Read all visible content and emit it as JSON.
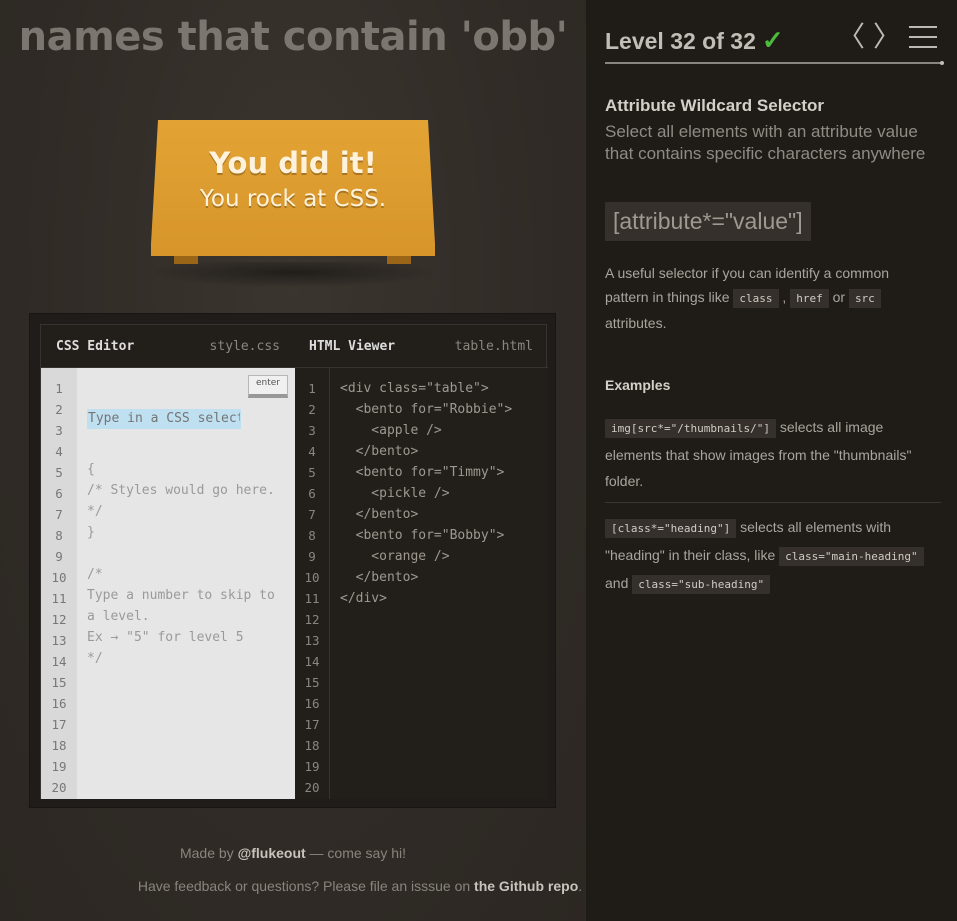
{
  "game": {
    "instruction": "names that contain 'obb'",
    "winner": {
      "title": "You did it!",
      "subtitle": "You rock at CSS."
    }
  },
  "editor": {
    "css_title": "CSS Editor",
    "css_file": "style.css",
    "html_title": "HTML Viewer",
    "html_file": "table.html",
    "input_placeholder": "Type in a CSS selector",
    "enter_label": "enter",
    "line_numbers": [
      "1",
      "2",
      "3",
      "4",
      "5",
      "6",
      "7",
      "8",
      "9",
      "10",
      "11",
      "12",
      "13",
      "14",
      "15",
      "16",
      "17",
      "18",
      "19",
      "20"
    ],
    "css_lines": [
      "{",
      "/* Styles would go here.",
      "*/",
      "}",
      "",
      "/*",
      "Type a number to skip to",
      "a level.",
      "Ex → \"5\" for level 5",
      "*/"
    ],
    "html_lines": [
      "<div class=\"table\">",
      "  <bento for=\"Robbie\">",
      "    <apple />",
      "  </bento>",
      "  <bento for=\"Timmy\">",
      "    <pickle />",
      "  </bento>",
      "  <bento for=\"Bobby\">",
      "    <orange />",
      "  </bento>",
      "</div>"
    ]
  },
  "credits": {
    "made_by_prefix": "Made by ",
    "author": "@flukeout",
    "made_by_suffix": " — come say hi!",
    "feedback_prefix": "Have feedback or questions? Please file an isssue on ",
    "repo_link": "the Github repo",
    "feedback_suffix": "."
  },
  "sidebar": {
    "level_text": "Level 32 of 32",
    "checkmark": "✓",
    "prev_icon": "〈",
    "next_icon": "〉",
    "progress": 1.0,
    "selector_name": "Attribute Wildcard Selector",
    "selector_title": "Select all elements with an attribute value that contains specific characters anywhere",
    "syntax": "[attribute*=\"value\"]",
    "hint": {
      "text1": "A useful selector if you can identify a common pattern in things like ",
      "code1": "class",
      "sep1": " , ",
      "code2": "href",
      "sep2": " or ",
      "code3": "src",
      "text2": " attributes."
    },
    "examples_title": "Examples",
    "example1": {
      "code": "img[src*=\"/thumbnails/\"]",
      "text": " selects all image elements that show images from the \"thumbnails\" folder."
    },
    "example2": {
      "code": "[class*=\"heading\"]",
      "text1": " selects all elements with \"heading\" in their class, like ",
      "code2": "class=\"main-heading\"",
      "text2": " and ",
      "code3": "class=\"sub-heading\""
    }
  }
}
